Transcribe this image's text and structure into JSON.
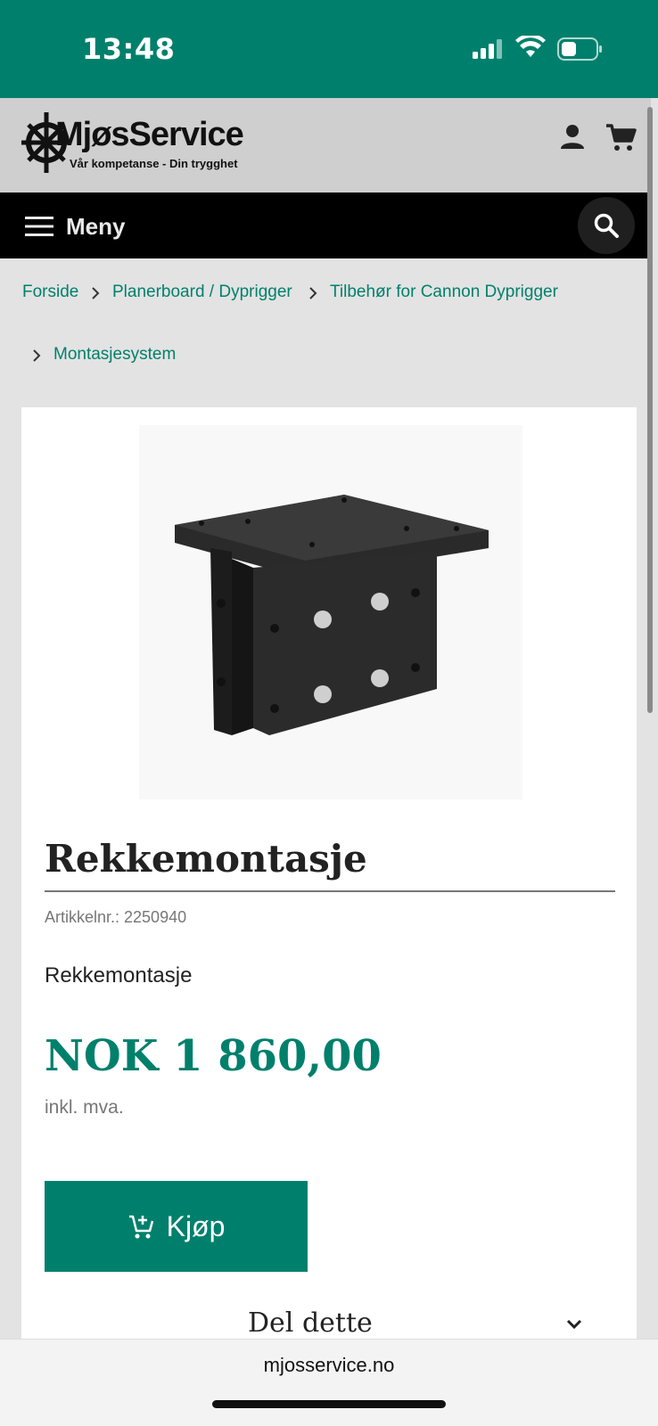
{
  "status_bar": {
    "time": "13:48"
  },
  "header": {
    "brand": "MjøsService",
    "tagline": "Vår kompetanse - Din trygghet"
  },
  "nav": {
    "menu_label": "Meny"
  },
  "breadcrumb": {
    "items": [
      "Forside",
      "Planerboard / Dyprigger",
      "Tilbehør for Cannon Dyprigger",
      "Montasjesystem"
    ]
  },
  "product": {
    "title": "Rekkemontasje",
    "sku": "Artikkelnr.: 2250940",
    "description": "Rekkemontasje",
    "price": "NOK 1 860,00",
    "vat_note": "inkl. mva.",
    "buy_label": "Kjøp",
    "share_label": "Del dette"
  },
  "browser": {
    "url": "mjosservice.no"
  },
  "colors": {
    "accent": "#00806c",
    "nav_bg": "#000000",
    "header_bg": "#cfcfcf"
  }
}
